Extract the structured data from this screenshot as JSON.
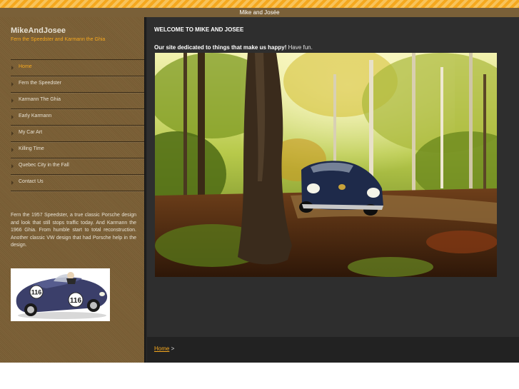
{
  "header": {
    "title": "Mike and Josée"
  },
  "sidebar": {
    "site_name": "MikeAndJosee",
    "tagline": "Fern the Speedster and Karmann the Ghia",
    "nav": [
      {
        "label": "Home",
        "active": true
      },
      {
        "label": "Fern the Speedster",
        "active": false
      },
      {
        "label": "Karmann The Ghia",
        "active": false
      },
      {
        "label": "Early Karmann",
        "active": false
      },
      {
        "label": "My Car Art",
        "active": false
      },
      {
        "label": "Killing Time",
        "active": false
      },
      {
        "label": "Quebec City in the Fall",
        "active": false
      },
      {
        "label": "Contact Us",
        "active": false
      }
    ],
    "description": "Fern the 1957 Speedster, a true classic Porsche design and look that still stops traffic today. And Karmann the 1966 Ghia. From humble start to total reconstruction. Another classic VW design that had Porsche help in the design.",
    "car_number": "116"
  },
  "main": {
    "heading": "WELCOME TO MIKE AND JOSEE",
    "intro_bold": "Our site dedicated to things that make us happy!",
    "intro_rest": " Have fun."
  },
  "footer": {
    "home_link": "Home",
    "separator": " >"
  },
  "colors": {
    "accent": "#f5a81f",
    "sidebar": "#7b5f35",
    "main_bg": "#2e2e2e",
    "footer_bg": "#222222"
  }
}
